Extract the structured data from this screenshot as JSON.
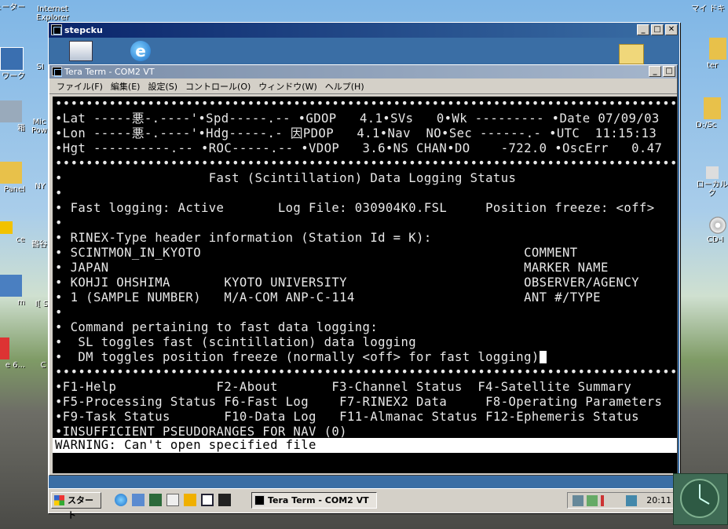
{
  "desktop": {
    "left_icons": [
      {
        "label": "ューター"
      },
      {
        "label": "ワーク"
      },
      {
        "label": "箱"
      },
      {
        "label": "Panel"
      },
      {
        "label": "ce"
      },
      {
        "label": "m"
      },
      {
        "label": "e 6..."
      }
    ],
    "column2_icons": [
      {
        "label": "Internet Explorer"
      },
      {
        "label": "SI"
      },
      {
        "label": "Mic Pow"
      },
      {
        "label": "NY"
      },
      {
        "label": "鶴谷"
      },
      {
        "label": "I[ S"
      },
      {
        "label": "C"
      }
    ],
    "right_icons": [
      {
        "label": "マイ ドキ"
      },
      {
        "label": "ter"
      },
      {
        "label": "D:/Sc"
      },
      {
        "label": "ローカル ク"
      },
      {
        "label": "CD-I"
      }
    ]
  },
  "outer_window": {
    "title": "stepcku",
    "buttons": {
      "minimize": "_",
      "maximize": "□",
      "close": "✕"
    }
  },
  "teraterm": {
    "title": "Tera Term - COM2 VT",
    "menu": [
      "ファイル(F)",
      "編集(E)",
      "設定(S)",
      "コントロール(O)",
      "ウィンドウ(W)",
      "ヘルプ(H)"
    ]
  },
  "terminal": {
    "lines": [
      "•••••••••••••••••••••••••••••••••••••••••••••••••••••••••••••••••••••••••••••••••••",
      "•Lat -----悪-.----'•Spd-----.-- •GDOP   4.1•SVs   0•Wk --------- •Date 07/09/03",
      "•Lon -----悪-.----'•Hdg-----.- 因PDOP   4.1•Nav  NO•Sec ------.- •UTC  11:15:13",
      "•Hgt ----------.-- •ROC-----.-- •VDOP   3.6•NS CHAN•DO    -722.0 •OscErr   0.47",
      "•••••••••••••••••••••••••••••••••••••••••••••••••••••••••••••••••••••••••••••••••••",
      "•                   Fast (Scintillation) Data Logging Status",
      "•",
      "• Fast logging: Active       Log File: 030904K0.FSL     Position freeze: <off>",
      "•",
      "• RINEX-Type header information (Station Id = K):",
      "• SCINTMON_IN_KYOTO                                          COMMENT",
      "• JAPAN                                                      MARKER NAME",
      "• KOHJI OHSHIMA       KYOTO UNIVERSITY                       OBSERVER/AGENCY",
      "• 1 (SAMPLE NUMBER)   M/A-COM ANP-C-114                      ANT #/TYPE",
      "•",
      "• Command pertaining to fast data logging:",
      "•  SL toggles fast (scintillation) data logging",
      "•  DM toggles position freeze (normally <off> for fast logging)",
      "•••••••••••••••••••••••••••••••••••••••••••••••••••••••••••••••••••••••••••••••••••",
      "•F1-Help             F2-About       F3-Channel Status  F4-Satellite Summary",
      "•F5-Processing Status F6-Fast Log    F7-RINEX2 Data     F8-Operating Parameters",
      "•F9-Task Status       F10-Data Log   F11-Almanac Status F12-Ephemeris Status",
      "•INSUFFICIENT PSEUDORANGES FOR NAV (0)"
    ],
    "warning": "WARNING: Can't open specified file"
  },
  "taskbar": {
    "start": "スタート",
    "task": "Tera Term - COM2 VT",
    "clock": "20:11"
  }
}
